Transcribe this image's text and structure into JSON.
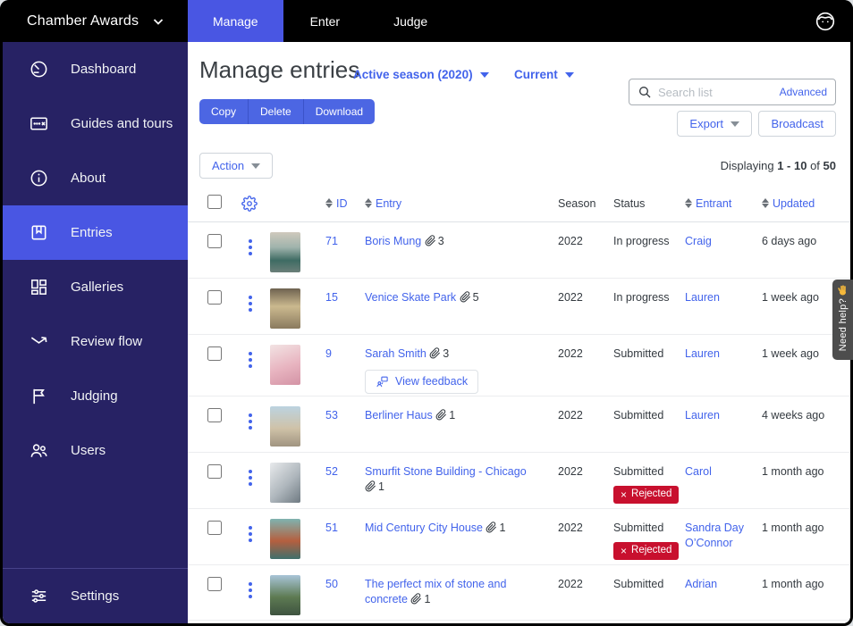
{
  "topbar": {
    "brand": "Chamber Awards",
    "tabs": [
      {
        "label": "Manage",
        "active": true
      },
      {
        "label": "Enter",
        "active": false
      },
      {
        "label": "Judge",
        "active": false
      }
    ]
  },
  "sidebar": {
    "items": [
      {
        "label": "Dashboard",
        "icon": "dashboard-icon",
        "active": false
      },
      {
        "label": "Guides and tours",
        "icon": "map-icon",
        "active": false
      },
      {
        "label": "About",
        "icon": "info-icon",
        "active": false
      },
      {
        "label": "Entries",
        "icon": "bookmark-icon",
        "active": true
      },
      {
        "label": "Galleries",
        "icon": "grid-icon",
        "active": false
      },
      {
        "label": "Review flow",
        "icon": "flow-arrow-icon",
        "active": false
      },
      {
        "label": "Judging",
        "icon": "flag-icon",
        "active": false
      },
      {
        "label": "Users",
        "icon": "users-icon",
        "active": false
      }
    ],
    "settings": {
      "label": "Settings",
      "icon": "sliders-icon"
    }
  },
  "header": {
    "title": "Manage entries",
    "season_dropdown": "Active season (2020)",
    "filter_dropdown": "Current"
  },
  "search": {
    "placeholder": "Search list",
    "advanced_label": "Advanced"
  },
  "toolbar": {
    "bulk_buttons": [
      "Copy",
      "Delete",
      "Download"
    ],
    "export_label": "Export",
    "broadcast_label": "Broadcast",
    "action_label": "Action",
    "displaying_prefix": "Displaying",
    "displaying_range": "1 - 10",
    "displaying_of": "of",
    "displaying_total": "50"
  },
  "help_tab": {
    "label": "Need help?",
    "icon": "waving-hand-icon"
  },
  "table": {
    "columns": {
      "id": "ID",
      "entry": "Entry",
      "season": "Season",
      "status": "Status",
      "entrant": "Entrant",
      "updated": "Updated"
    },
    "rows": [
      {
        "id": "71",
        "title": "Boris Mung",
        "attachments": "3",
        "season": "2022",
        "status": "In progress",
        "entrant": "Craig",
        "updated": "6 days ago",
        "thumbnail": "street-scene-photo"
      },
      {
        "id": "15",
        "title": "Venice Skate Park",
        "attachments": "5",
        "season": "2022",
        "status": "In progress",
        "entrant": "Lauren",
        "updated": "1 week ago",
        "thumbnail": "palm-trees-photo"
      },
      {
        "id": "9",
        "title": "Sarah Smith",
        "attachments": "3",
        "season": "2022",
        "status": "Submitted",
        "entrant": "Lauren",
        "updated": "1 week ago",
        "feedback_button": "View feedback",
        "thumbnail": "portrait-photo"
      },
      {
        "id": "53",
        "title": "Berliner Haus",
        "attachments": "1",
        "season": "2022",
        "status": "Submitted",
        "entrant": "Lauren",
        "updated": "4 weeks ago",
        "thumbnail": "building-facade-photo"
      },
      {
        "id": "52",
        "title": "Smurfit Stone Building - Chicago",
        "attachments": "1",
        "season": "2022",
        "status": "Submitted",
        "rejected_label": "Rejected",
        "entrant": "Carol",
        "updated": "1 month ago",
        "thumbnail": "skyscraper-photo"
      },
      {
        "id": "51",
        "title": "Mid Century City House",
        "attachments": "1",
        "season": "2022",
        "status": "Submitted",
        "rejected_label": "Rejected",
        "entrant": "Sandra Day O’Connor",
        "updated": "1 month ago",
        "thumbnail": "city-house-photo"
      },
      {
        "id": "50",
        "title": "The perfect mix of stone and concrete",
        "attachments": "1",
        "season": "2022",
        "status": "Submitted",
        "entrant": "Adrian",
        "updated": "1 month ago",
        "thumbnail": "alley-photo"
      }
    ]
  },
  "colors": {
    "accent_blue": "#4956e3",
    "link_blue": "#4263eb",
    "sidebar_navy": "#272264",
    "rejected_red": "#c8102e",
    "help_tab_gray": "#4d4d4d"
  }
}
